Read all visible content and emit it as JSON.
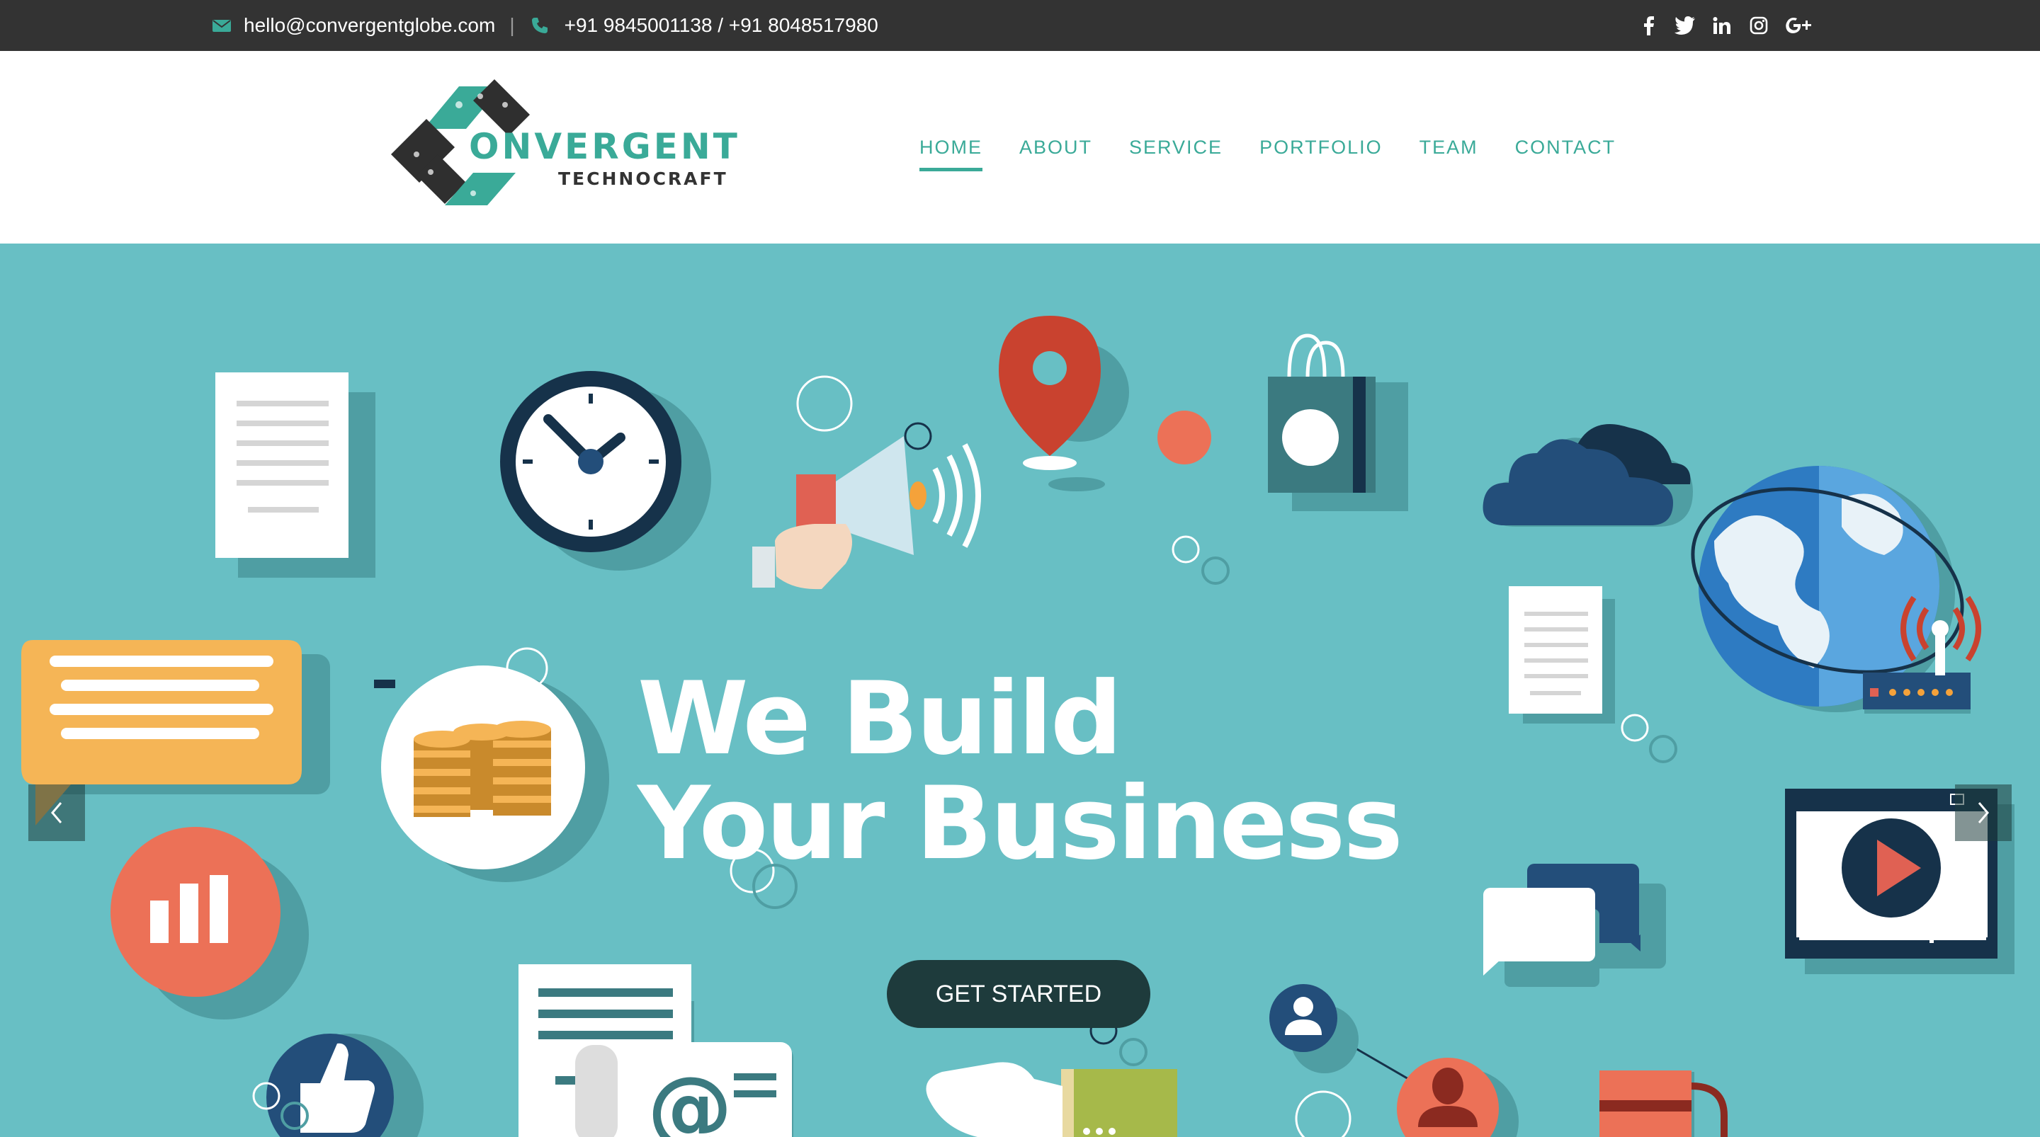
{
  "topbar": {
    "email": "hello@convergentglobe.com",
    "separator": "|",
    "phone": "+91 9845001138 / +91 8048517980",
    "social": [
      "facebook-icon",
      "twitter-icon",
      "linkedin-icon",
      "instagram-icon",
      "google-plus-icon"
    ]
  },
  "brand": {
    "name_main": "ONVERGENT",
    "name_sub": "TECHNOCRAFT",
    "color": "#3aaa98"
  },
  "nav": {
    "items": [
      "HOME",
      "ABOUT",
      "SERVICE",
      "PORTFOLIO",
      "TEAM",
      "CONTACT"
    ],
    "active": "HOME"
  },
  "hero": {
    "title_line1": "We Build",
    "title_line2": "Your Business",
    "cta_label": "GET STARTED",
    "background": "#68bfc4"
  },
  "carousel": {
    "prev": "chevron-left-icon",
    "next": "chevron-right-icon"
  }
}
